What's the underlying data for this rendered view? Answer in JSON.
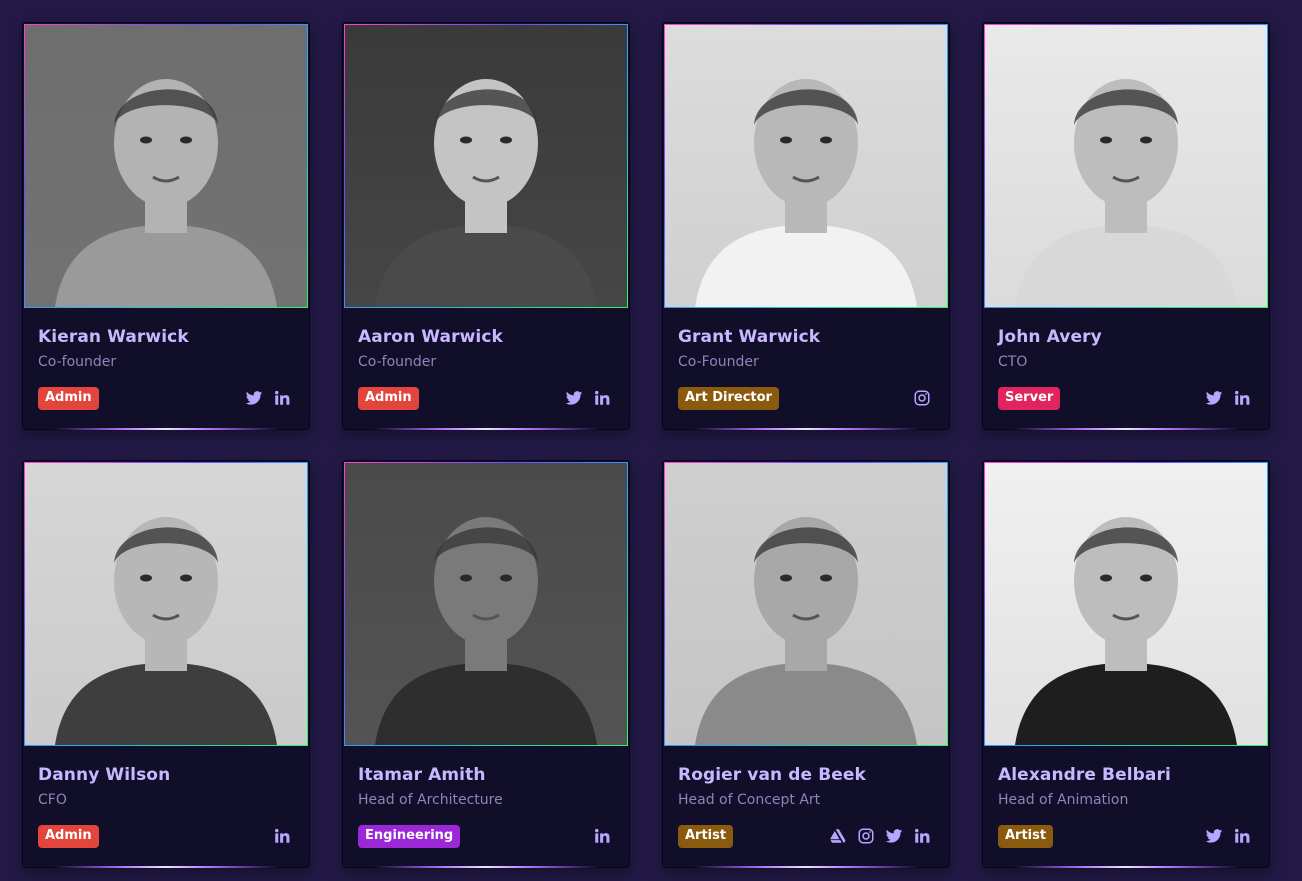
{
  "team": [
    {
      "name": "Kieran Warwick",
      "role": "Co-founder",
      "badge": {
        "label": "Admin",
        "color": "#e1453c"
      },
      "socials": [
        "twitter",
        "linkedin"
      ],
      "photo_tone": {
        "bg": "#6e6e6e",
        "face": "#b3b3b3",
        "shirt": "#9a9a9a"
      }
    },
    {
      "name": "Aaron Warwick",
      "role": "Co-founder",
      "badge": {
        "label": "Admin",
        "color": "#e1453c"
      },
      "socials": [
        "twitter",
        "linkedin"
      ],
      "photo_tone": {
        "bg": "#3a3a3a",
        "face": "#c4c4c4",
        "shirt": "#4a4a4a"
      }
    },
    {
      "name": "Grant Warwick",
      "role": "Co-Founder",
      "badge": {
        "label": "Art Director",
        "color": "#8a5a0e"
      },
      "socials": [
        "instagram"
      ],
      "photo_tone": {
        "bg": "#dcdcdc",
        "face": "#b8b8b8",
        "shirt": "#f2f2f2"
      }
    },
    {
      "name": "John Avery",
      "role": "CTO",
      "badge": {
        "label": "Server",
        "color": "#e0245e"
      },
      "socials": [
        "twitter",
        "linkedin"
      ],
      "photo_tone": {
        "bg": "#e9e9e9",
        "face": "#bdbdbd",
        "shirt": "#d8d8d8"
      }
    },
    {
      "name": "Danny Wilson",
      "role": "CFO",
      "badge": {
        "label": "Admin",
        "color": "#e1453c"
      },
      "socials": [
        "linkedin"
      ],
      "photo_tone": {
        "bg": "#d6d6d6",
        "face": "#b7b7b7",
        "shirt": "#3e3e3e"
      }
    },
    {
      "name": "Itamar Amith",
      "role": "Head of Architecture",
      "badge": {
        "label": "Engineering",
        "color": "#9b27d6"
      },
      "socials": [
        "linkedin"
      ],
      "photo_tone": {
        "bg": "#4a4a4a",
        "face": "#7a7a7a",
        "shirt": "#2e2e2e"
      }
    },
    {
      "name": "Rogier van de Beek",
      "role": "Head of Concept Art",
      "badge": {
        "label": "Artist",
        "color": "#8a5a0e"
      },
      "socials": [
        "artstation",
        "instagram",
        "twitter",
        "linkedin"
      ],
      "photo_tone": {
        "bg": "#cfcfcf",
        "face": "#a8a8a8",
        "shirt": "#8a8a8a"
      }
    },
    {
      "name": "Alexandre Belbari",
      "role": "Head of Animation",
      "badge": {
        "label": "Artist",
        "color": "#8a5a0e"
      },
      "socials": [
        "twitter",
        "linkedin"
      ],
      "photo_tone": {
        "bg": "#f0f0f0",
        "face": "#bdbdbd",
        "shirt": "#1e1e1e"
      }
    }
  ],
  "icons": {
    "twitter": "twitter-icon",
    "linkedin": "linkedin-icon",
    "instagram": "instagram-icon",
    "artstation": "artstation-icon"
  },
  "accent": {
    "name_color": "#c9b8ff",
    "role_color": "#8f84b8",
    "page_bg": "#221a45",
    "card_bg": "#110e2a"
  }
}
